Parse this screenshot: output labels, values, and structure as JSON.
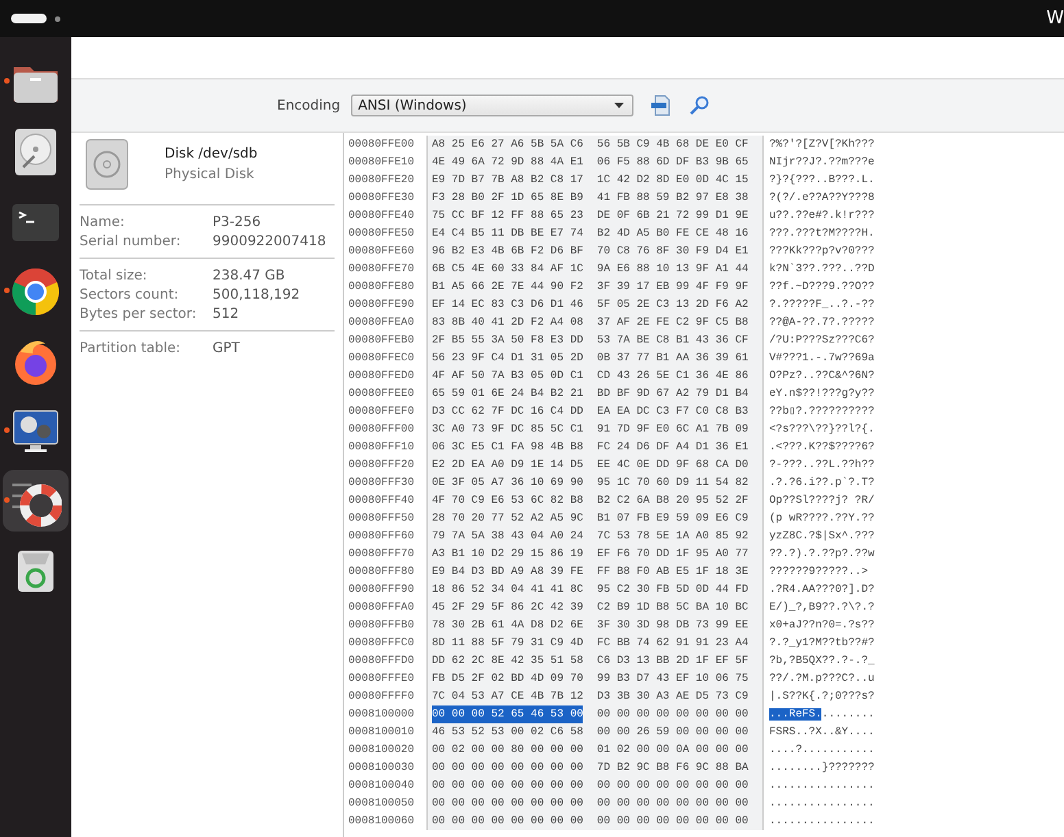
{
  "top_bar": {
    "right_text": "W"
  },
  "dock": [
    {
      "kind": "folder",
      "running": true,
      "selected": false
    },
    {
      "kind": "disk",
      "running": false,
      "selected": false
    },
    {
      "kind": "terminal",
      "running": false,
      "selected": false
    },
    {
      "kind": "ring",
      "running": true,
      "selected": false
    },
    {
      "kind": "flame",
      "running": false,
      "selected": false
    },
    {
      "kind": "monitor",
      "running": true,
      "selected": false
    },
    {
      "kind": "lifebuoy",
      "running": true,
      "selected": true
    },
    {
      "kind": "trash",
      "running": false,
      "selected": false
    }
  ],
  "toolbar": {
    "encoding_label": "Encoding",
    "encoding_value": "ANSI (Windows)"
  },
  "disk_panel": {
    "title": "Disk /dev/sdb",
    "subtitle": "Physical Disk",
    "groups": [
      [
        {
          "label": "Name:",
          "value": "P3-256"
        },
        {
          "label": "Serial number:",
          "value": "9900922007418"
        }
      ],
      [
        {
          "label": "Total size:",
          "value": "238.47 GB"
        },
        {
          "label": "Sectors count:",
          "value": "500,118,192"
        },
        {
          "label": "Bytes per sector:",
          "value": "512"
        }
      ],
      [
        {
          "label": "Partition table:",
          "value": "GPT"
        }
      ]
    ]
  },
  "hex_view": {
    "rows": [
      {
        "address": "00080FFE00",
        "hex_left": "A8 25 E6 27 A6 5B 5A C6",
        "hex_right": "56 5B C9 4B 68 DE E0 CF",
        "ascii": "?%?'?[Z?V[?Kh???",
        "selected": false
      },
      {
        "address": "00080FFE10",
        "hex_left": "4E 49 6A 72 9D 88 4A E1",
        "hex_right": "06 F5 88 6D DF B3 9B 65",
        "ascii": "NIjr??J?.??m???e",
        "selected": false
      },
      {
        "address": "00080FFE20",
        "hex_left": "E9 7D B7 7B A8 B2 C8 17",
        "hex_right": "1C 42 D2 8D E0 0D 4C 15",
        "ascii": "?}?{???..B???.L.",
        "selected": false
      },
      {
        "address": "00080FFE30",
        "hex_left": "F3 28 B0 2F 1D 65 8E B9",
        "hex_right": "41 FB 88 59 B2 97 E8 38",
        "ascii": "?(?/.e??A??Y???8",
        "selected": false
      },
      {
        "address": "00080FFE40",
        "hex_left": "75 CC BF 12 FF 88 65 23",
        "hex_right": "DE 0F 6B 21 72 99 D1 9E",
        "ascii": "u??.??e#?.k!r???",
        "selected": false
      },
      {
        "address": "00080FFE50",
        "hex_left": "E4 C4 B5 11 DB BE E7 74",
        "hex_right": "B2 4D A5 B0 FE CE 48 16",
        "ascii": "???.???t?M????H.",
        "selected": false
      },
      {
        "address": "00080FFE60",
        "hex_left": "96 B2 E3 4B 6B F2 D6 BF",
        "hex_right": "70 C8 76 8F 30 F9 D4 E1",
        "ascii": "???Kk???p?v?0???",
        "selected": false
      },
      {
        "address": "00080FFE70",
        "hex_left": "6B C5 4E 60 33 84 AF 1C",
        "hex_right": "9A E6 88 10 13 9F A1 44",
        "ascii": "k?N`3??.???..??D",
        "selected": false
      },
      {
        "address": "00080FFE80",
        "hex_left": "B1 A5 66 2E 7E 44 90 F2",
        "hex_right": "3F 39 17 EB 99 4F F9 9F",
        "ascii": "??f.~D???9.??O??",
        "selected": false
      },
      {
        "address": "00080FFE90",
        "hex_left": "EF 14 EC 83 C3 D6 D1 46",
        "hex_right": "5F 05 2E C3 13 2D F6 A2",
        "ascii": "?.?????F_..?.-??",
        "selected": false
      },
      {
        "address": "00080FFEA0",
        "hex_left": "83 8B 40 41 2D F2 A4 08",
        "hex_right": "37 AF 2E FE C2 9F C5 B8",
        "ascii": "??@A-??.7?.?????",
        "selected": false
      },
      {
        "address": "00080FFEB0",
        "hex_left": "2F B5 55 3A 50 F8 E3 DD",
        "hex_right": "53 7A BE C8 B1 43 36 CF",
        "ascii": "/?U:P???Sz???C6?",
        "selected": false
      },
      {
        "address": "00080FFEC0",
        "hex_left": "56 23 9F C4 D1 31 05 2D",
        "hex_right": "0B 37 77 B1 AA 36 39 61",
        "ascii": "V#???1.-.7w??69a",
        "selected": false
      },
      {
        "address": "00080FFED0",
        "hex_left": "4F AF 50 7A B3 05 0D C1",
        "hex_right": "CD 43 26 5E C1 36 4E 86",
        "ascii": "O?Pz?..??C&^?6N?",
        "selected": false
      },
      {
        "address": "00080FFEE0",
        "hex_left": "65 59 01 6E 24 B4 B2 21",
        "hex_right": "BD BF 9D 67 A2 79 D1 B4",
        "ascii": "eY.n$??!???g?y??",
        "selected": false
      },
      {
        "address": "00080FFEF0",
        "hex_left": "D3 CC 62 7F DC 16 C4 DD",
        "hex_right": "EA EA DC C3 F7 C0 C8 B3",
        "ascii": "??b▯?.??????????",
        "selected": false
      },
      {
        "address": "00080FFF00",
        "hex_left": "3C A0 73 9F DC 85 5C C1",
        "hex_right": "91 7D 9F E0 6C A1 7B 09",
        "ascii": "<?s???\\??}??l?{.",
        "selected": false
      },
      {
        "address": "00080FFF10",
        "hex_left": "06 3C E5 C1 FA 98 4B B8",
        "hex_right": "FC 24 D6 DF A4 D1 36 E1",
        "ascii": ".<???.K??$????6?",
        "selected": false
      },
      {
        "address": "00080FFF20",
        "hex_left": "E2 2D EA A0 D9 1E 14 D5",
        "hex_right": "EE 4C 0E DD 9F 68 CA D0",
        "ascii": "?-???..??L.??h??",
        "selected": false
      },
      {
        "address": "00080FFF30",
        "hex_left": "0E 3F 05 A7 36 10 69 90",
        "hex_right": "95 1C 70 60 D9 11 54 82",
        "ascii": ".?.?6.i??.p`?.T?",
        "selected": false
      },
      {
        "address": "00080FFF40",
        "hex_left": "4F 70 C9 E6 53 6C 82 B8",
        "hex_right": "B2 C2 6A B8 20 95 52 2F",
        "ascii": "Op??Sl????j? ?R/",
        "selected": false
      },
      {
        "address": "00080FFF50",
        "hex_left": "28 70 20 77 52 A2 A5 9C",
        "hex_right": "B1 07 FB E9 59 09 E6 C9",
        "ascii": "(p wR????.??Y.??",
        "selected": false
      },
      {
        "address": "00080FFF60",
        "hex_left": "79 7A 5A 38 43 04 A0 24",
        "hex_right": "7C 53 78 5E 1A A0 85 92",
        "ascii": "yzZ8C.?$|Sx^.???",
        "selected": false
      },
      {
        "address": "00080FFF70",
        "hex_left": "A3 B1 10 D2 29 15 86 19",
        "hex_right": "EF F6 70 DD 1F 95 A0 77",
        "ascii": "??.?).?.??p?.??w",
        "selected": false
      },
      {
        "address": "00080FFF80",
        "hex_left": "E9 B4 D3 BD A9 A8 39 FE",
        "hex_right": "FF B8 F0 AB E5 1F 18 3E",
        "ascii": "??????9?????..>",
        "selected": false
      },
      {
        "address": "00080FFF90",
        "hex_left": "18 86 52 34 04 41 41 8C",
        "hex_right": "95 C2 30 FB 5D 0D 44 FD",
        "ascii": ".?R4.AA???0?].D?",
        "selected": false
      },
      {
        "address": "00080FFFA0",
        "hex_left": "45 2F 29 5F 86 2C 42 39",
        "hex_right": "C2 B9 1D B8 5C BA 10 BC",
        "ascii": "E/)_?,B9??.?\\?.?",
        "selected": false
      },
      {
        "address": "00080FFFB0",
        "hex_left": "78 30 2B 61 4A D8 D2 6E",
        "hex_right": "3F 30 3D 98 DB 73 99 EE",
        "ascii": "x0+aJ??n?0=.?s??",
        "selected": false
      },
      {
        "address": "00080FFFC0",
        "hex_left": "8D 11 88 5F 79 31 C9 4D",
        "hex_right": "FC BB 74 62 91 91 23 A4",
        "ascii": "?.?_y1?M??tb??#?",
        "selected": false
      },
      {
        "address": "00080FFFD0",
        "hex_left": "DD 62 2C 8E 42 35 51 58",
        "hex_right": "C6 D3 13 BB 2D 1F EF 5F",
        "ascii": "?b,?B5QX??.?-.?_",
        "selected": false
      },
      {
        "address": "00080FFFE0",
        "hex_left": "FB D5 2F 02 BD 4D 09 70",
        "hex_right": "99 B3 D7 43 EF 10 06 75",
        "ascii": "??/.?M.p???C?..u",
        "selected": false
      },
      {
        "address": "00080FFFF0",
        "hex_left": "7C 04 53 A7 CE 4B 7B 12",
        "hex_right": "D3 3B 30 A3 AE D5 73 C9",
        "ascii": "|.S??K{.?;0???s?",
        "selected": false
      },
      {
        "address": "0008100000",
        "hex_left": "00 00 00 52 65 46 53 00",
        "hex_right": "00 00 00 00 00 00 00 00",
        "ascii": "...ReFS.........",
        "selected": true
      },
      {
        "address": "0008100010",
        "hex_left": "46 53 52 53 00 02 C6 58",
        "hex_right": "00 00 26 59 00 00 00 00",
        "ascii": "FSRS..?X..&Y....",
        "selected": false
      },
      {
        "address": "0008100020",
        "hex_left": "00 02 00 00 80 00 00 00",
        "hex_right": "01 02 00 00 0A 00 00 00",
        "ascii": "....?...........",
        "selected": false
      },
      {
        "address": "0008100030",
        "hex_left": "00 00 00 00 00 00 00 00",
        "hex_right": "7D B2 9C B8 F6 9C 88 BA",
        "ascii": "........}???????",
        "selected": false
      },
      {
        "address": "0008100040",
        "hex_left": "00 00 00 00 00 00 00 00",
        "hex_right": "00 00 00 00 00 00 00 00",
        "ascii": "................",
        "selected": false
      },
      {
        "address": "0008100050",
        "hex_left": "00 00 00 00 00 00 00 00",
        "hex_right": "00 00 00 00 00 00 00 00",
        "ascii": "................",
        "selected": false
      },
      {
        "address": "0008100060",
        "hex_left": "00 00 00 00 00 00 00 00",
        "hex_right": "00 00 00 00 00 00 00 00",
        "ascii": "................",
        "selected": false
      }
    ]
  }
}
